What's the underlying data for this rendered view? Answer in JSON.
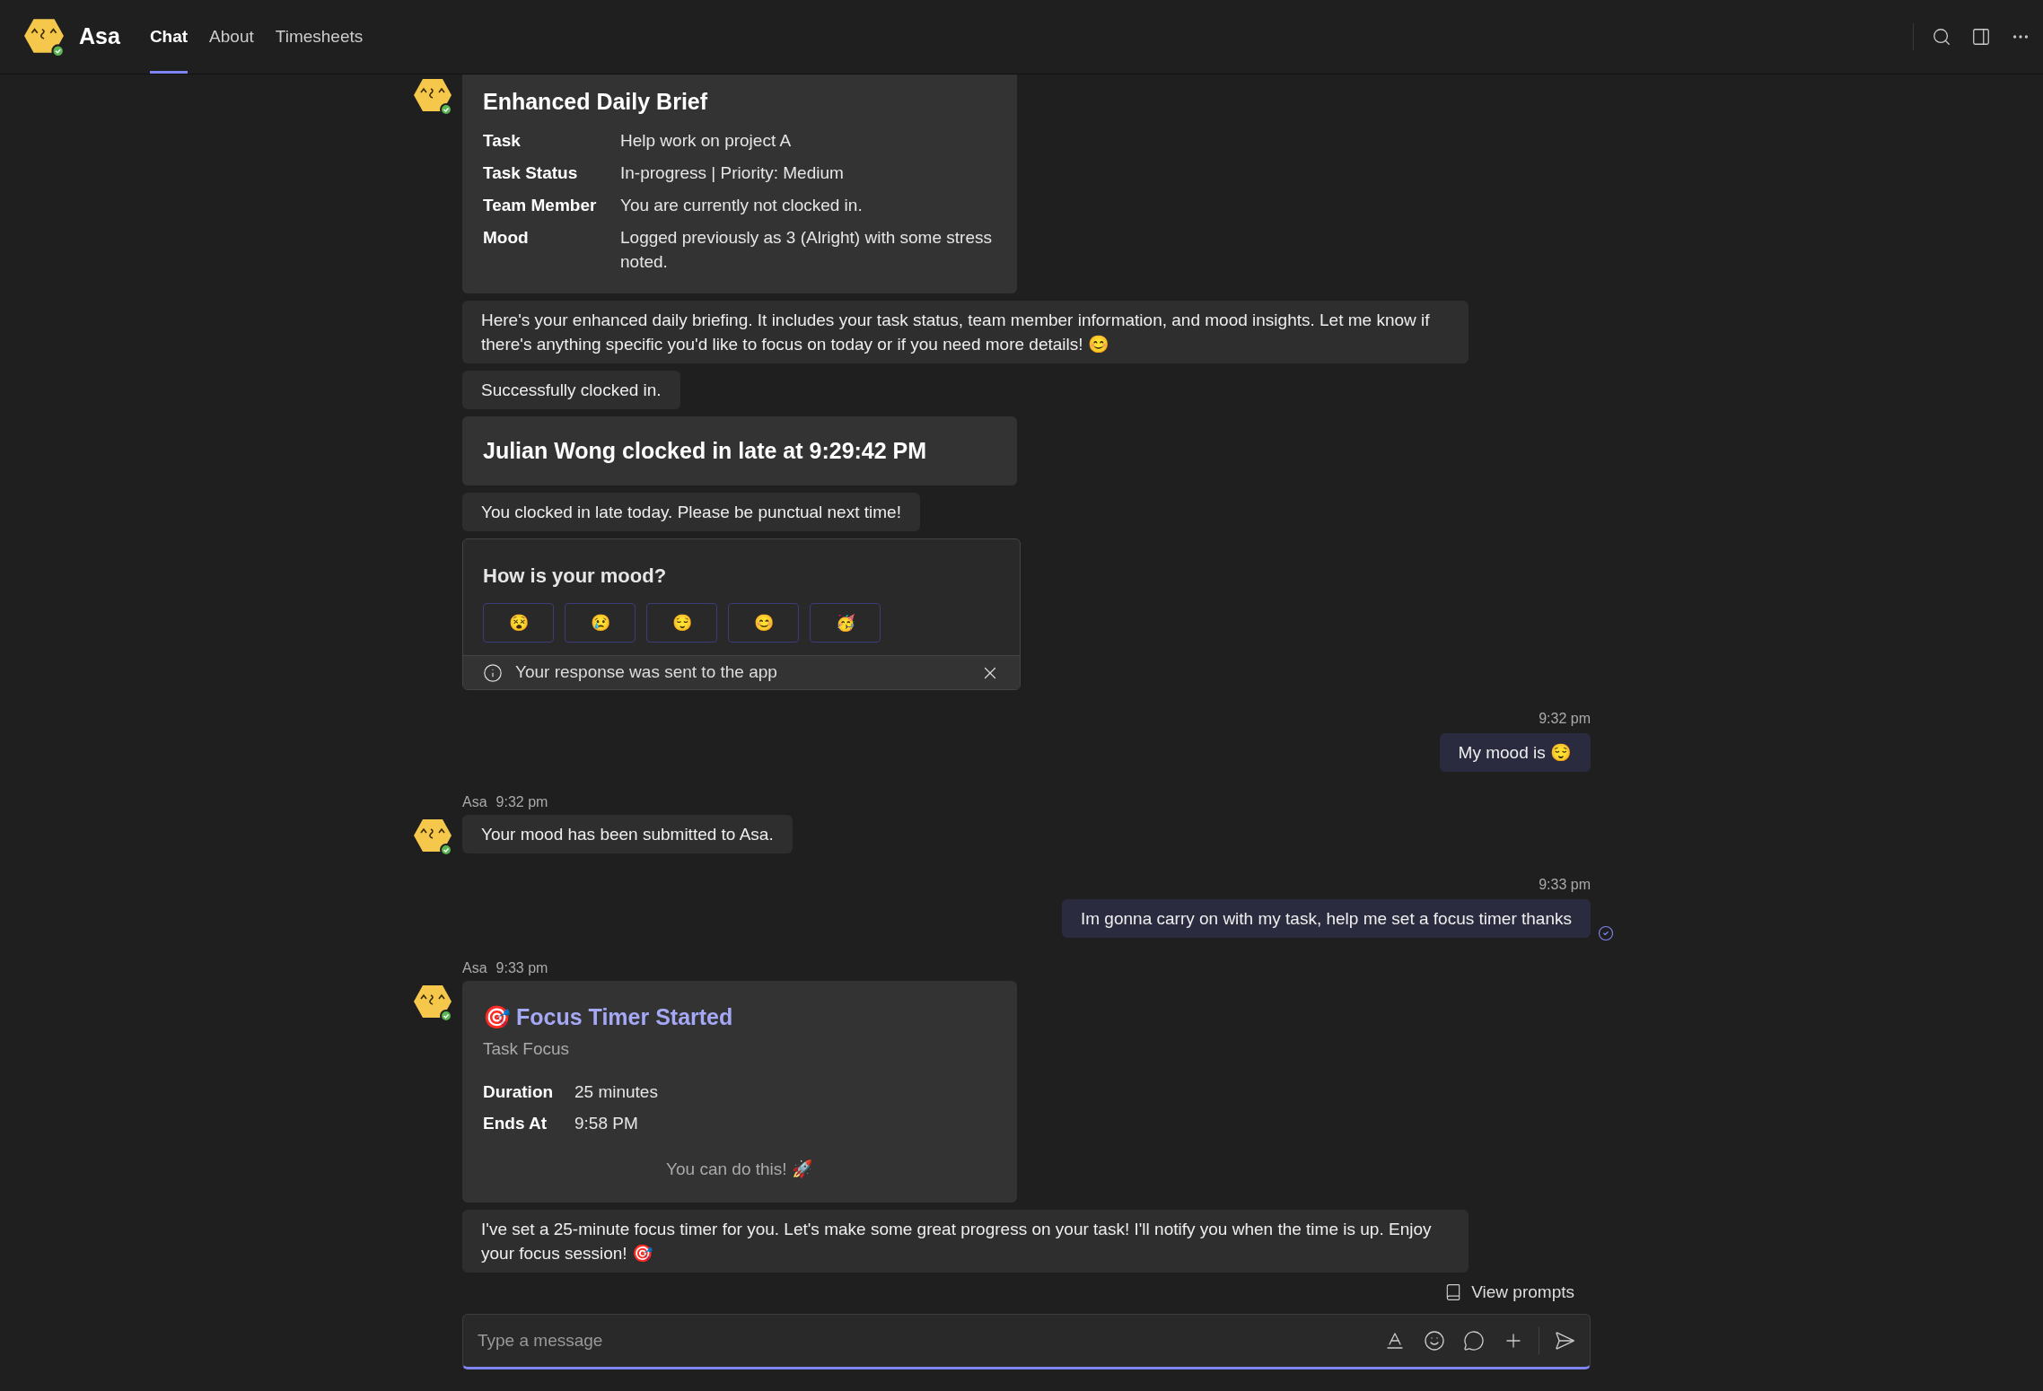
{
  "header": {
    "app_name": "Asa",
    "tabs": [
      {
        "label": "Chat",
        "selected": true
      },
      {
        "label": "About",
        "selected": false
      },
      {
        "label": "Timesheets",
        "selected": false
      }
    ]
  },
  "groups": [
    {
      "kind": "bot",
      "avatar": true,
      "items": [
        {
          "kind": "brief_card",
          "title": "Enhanced Daily Brief",
          "rows": [
            {
              "label": "Task",
              "value": "Help work on project A"
            },
            {
              "label": "Task Status",
              "value": "In-progress | Priority: Medium"
            },
            {
              "label": "Team Member",
              "value": "You are currently not clocked in."
            },
            {
              "label": "Mood",
              "value": "Logged previously as 3 (Alright) with some stress noted."
            }
          ]
        },
        {
          "kind": "text",
          "text": "Here's your enhanced daily briefing. It includes your task status, team member information, and mood insights. Let me know if there's anything specific you'd like to focus on today or if you need more details! 😊"
        },
        {
          "kind": "text",
          "text": "Successfully clocked in."
        },
        {
          "kind": "headline_card",
          "title": "Julian Wong clocked in late at 9:29:42 PM"
        },
        {
          "kind": "text",
          "text": "You clocked in late today. Please be punctual next time!"
        },
        {
          "kind": "mood_card",
          "question": "How is your mood?",
          "options": [
            "😵",
            "😢",
            "😌",
            "😊",
            "🥳"
          ],
          "notice": "Your response was sent to the app"
        }
      ]
    },
    {
      "kind": "user",
      "time": "9:32 pm",
      "items": [
        {
          "kind": "text",
          "text": "My mood is 😌",
          "seen": false
        }
      ]
    },
    {
      "kind": "bot",
      "avatar": true,
      "sender": "Asa",
      "time": "9:32 pm",
      "items": [
        {
          "kind": "text",
          "text": "Your mood has been submitted to Asa."
        }
      ]
    },
    {
      "kind": "user",
      "time": "9:33 pm",
      "items": [
        {
          "kind": "text",
          "text": "Im gonna carry on with my task, help me set a focus timer thanks",
          "seen": true
        }
      ]
    },
    {
      "kind": "bot",
      "avatar": true,
      "sender": "Asa",
      "time": "9:33 pm",
      "items": [
        {
          "kind": "timer_card",
          "emoji": "🎯",
          "title": "Focus Timer Started",
          "subtitle": "Task Focus",
          "rows": [
            {
              "label": "Duration",
              "value": "25 minutes"
            },
            {
              "label": "Ends At",
              "value": "9:58 PM"
            }
          ],
          "footer": "You can do this! 🚀"
        },
        {
          "kind": "text",
          "text": "I've set a 25-minute focus timer for you. Let's make some great progress on your task! I'll notify you when the time is up. Enjoy your focus session! 🎯"
        }
      ]
    }
  ],
  "composer": {
    "view_prompts": "View prompts",
    "placeholder": "Type a message"
  }
}
